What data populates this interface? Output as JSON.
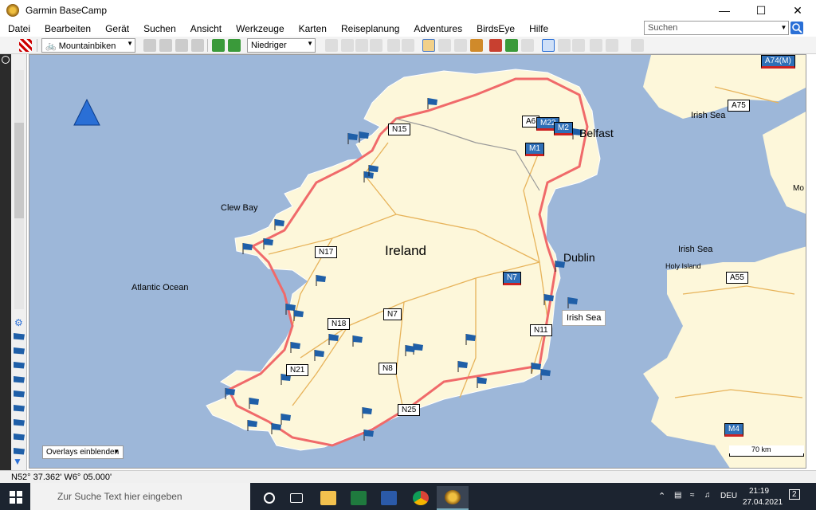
{
  "window": {
    "title": "Garmin BaseCamp"
  },
  "menu": [
    "Datei",
    "Bearbeiten",
    "Gerät",
    "Suchen",
    "Ansicht",
    "Werkzeuge",
    "Karten",
    "Reiseplanung",
    "Adventures",
    "BirdsEye",
    "Hilfe"
  ],
  "search": {
    "placeholder": "Suchen"
  },
  "toolbar": {
    "profile": "Mountainbiken",
    "detail": "Niedriger"
  },
  "map": {
    "labels": {
      "ireland": "Ireland",
      "atlantic": "Atlantic Ocean",
      "clew_bay": "Clew Bay",
      "belfast": "Belfast",
      "dublin": "Dublin",
      "irish_sea_1": "Irish Sea",
      "irish_sea_2": "Irish Sea",
      "holy_island": "Holy Island",
      "irish_sea_callout": "Irish Sea",
      "mo": "Mo"
    },
    "road_shields": {
      "n17": "N17",
      "n7a": "N7",
      "n7b": "N7",
      "n18": "N18",
      "n21": "N21",
      "n8": "N8",
      "n11": "N11",
      "n25": "N25",
      "n15": "N15",
      "a6": "A6",
      "m22": "M22",
      "m2": "M2",
      "m1": "M1",
      "a75": "A75",
      "a74": "A74(M)",
      "a55": "A55",
      "m4": "M4"
    },
    "overlay_button": "Overlays einblenden",
    "scale": "70 km"
  },
  "status": {
    "coords": "N52° 37.362' W6° 05.000'"
  },
  "taskbar": {
    "search_placeholder": "Zur Suche Text hier eingeben",
    "lang": "DEU",
    "time": "21:19",
    "date": "27.04.2021",
    "notifications": "2"
  }
}
